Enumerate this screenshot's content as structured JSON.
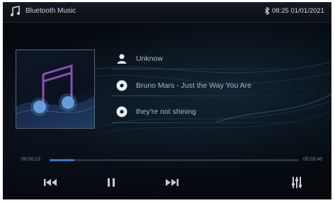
{
  "status_bar": {
    "app_icon": "music-note-icon",
    "title": "Bluetooth Music",
    "bluetooth_icon": "bluetooth-icon",
    "clock": "08:25 01/01/2021"
  },
  "album": {
    "art_icon": "music-note-icon"
  },
  "track_info": {
    "artist": {
      "icon": "person-icon",
      "text": "Unknow"
    },
    "title": {
      "icon": "disc-icon",
      "text": "Bruno Mars - Just the Way You Are"
    },
    "album": {
      "icon": "disc-icon",
      "text": "they're not shining"
    }
  },
  "playback": {
    "elapsed": "00:00:12",
    "total": "00:03:40",
    "progress_fraction": 0.1
  },
  "controls": {
    "previous_icon": "previous-track-icon",
    "pause_icon": "pause-icon",
    "next_icon": "next-track-icon",
    "equalizer_icon": "equalizer-icon"
  },
  "colors": {
    "accent": "#3b76c9",
    "background": "#05080d",
    "art_purple": "#8a4fb8",
    "art_blue": "#6aa8e6"
  }
}
